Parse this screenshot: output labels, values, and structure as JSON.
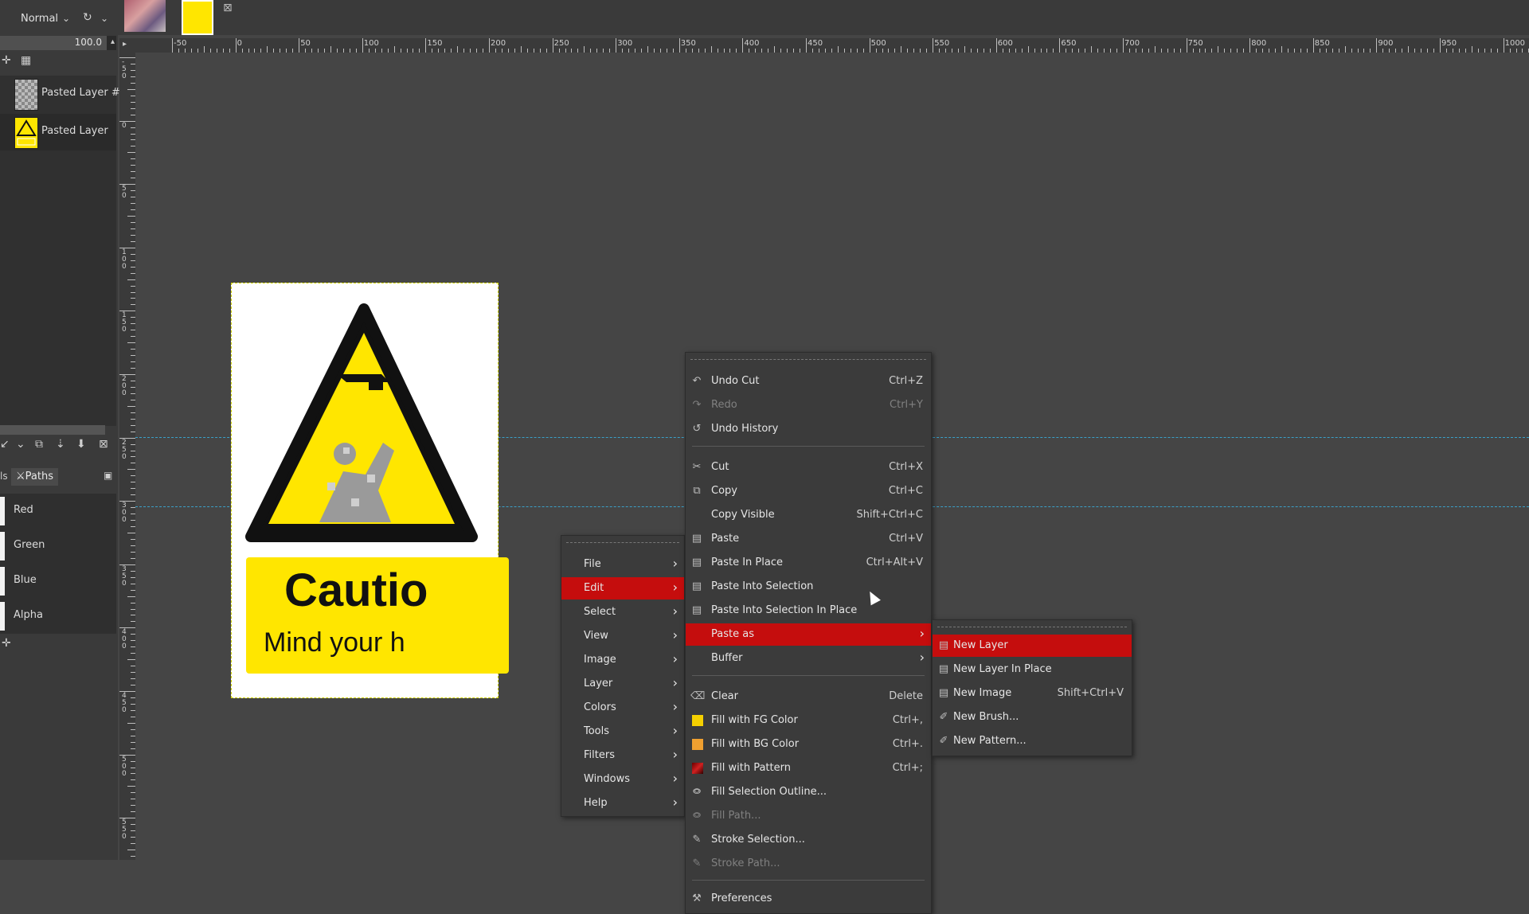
{
  "layers_panel": {
    "mode": "Normal",
    "opacity": "100.0",
    "layers": [
      {
        "name": "Pasted Layer #"
      },
      {
        "name": "Pasted Layer"
      }
    ]
  },
  "channels_panel": {
    "tab_label": "Paths",
    "tab_prefix": "ls",
    "channels": [
      "Red",
      "Green",
      "Blue",
      "Alpha"
    ]
  },
  "ruler": {
    "top_labels": [
      "-50",
      "0",
      "50",
      "100",
      "150",
      "200",
      "250",
      "300",
      "350",
      "400",
      "450",
      "500",
      "550",
      "600",
      "650",
      "700",
      "750",
      "800",
      "850",
      "900",
      "950",
      "1000"
    ],
    "left_labels": [
      "-50",
      "0",
      "50",
      "100",
      "150",
      "200",
      "250",
      "300",
      "350",
      "400",
      "450",
      "500",
      "550",
      "600"
    ]
  },
  "canvas_image": {
    "caution_title": "Cautio",
    "caution_subtitle": "Mind your h"
  },
  "main_menu": {
    "items": [
      "File",
      "Edit",
      "Select",
      "View",
      "Image",
      "Layer",
      "Colors",
      "Tools",
      "Filters",
      "Windows",
      "Help"
    ],
    "highlighted": "Edit"
  },
  "edit_menu": {
    "items": [
      {
        "label": "Undo Cut",
        "shortcut": "Ctrl+Z",
        "icon": "undo-icon",
        "enabled": true
      },
      {
        "label": "Redo",
        "shortcut": "Ctrl+Y",
        "icon": "redo-icon",
        "enabled": false
      },
      {
        "label": "Undo History",
        "shortcut": "",
        "icon": "history-icon",
        "enabled": true
      },
      {
        "label": "Cut",
        "shortcut": "Ctrl+X",
        "icon": "scissors-icon",
        "enabled": true
      },
      {
        "label": "Copy",
        "shortcut": "Ctrl+C",
        "icon": "copy-icon",
        "enabled": true
      },
      {
        "label": "Copy Visible",
        "shortcut": "Shift+Ctrl+C",
        "icon": "",
        "enabled": true
      },
      {
        "label": "Paste",
        "shortcut": "Ctrl+V",
        "icon": "paste-icon",
        "enabled": true
      },
      {
        "label": "Paste In Place",
        "shortcut": "Ctrl+Alt+V",
        "icon": "paste-icon",
        "enabled": true
      },
      {
        "label": "Paste Into Selection",
        "shortcut": "",
        "icon": "paste-icon",
        "enabled": true
      },
      {
        "label": "Paste Into Selection In Place",
        "shortcut": "",
        "icon": "paste-icon",
        "enabled": true
      },
      {
        "label": "Paste as",
        "shortcut": "",
        "icon": "",
        "enabled": true,
        "submenu": true
      },
      {
        "label": "Buffer",
        "shortcut": "",
        "icon": "",
        "enabled": true,
        "submenu": true
      },
      {
        "label": "Clear",
        "shortcut": "Delete",
        "icon": "clear-icon",
        "enabled": true
      },
      {
        "label": "Fill with FG Color",
        "shortcut": "Ctrl+,",
        "icon": "fg-color-swatch",
        "enabled": true
      },
      {
        "label": "Fill with BG Color",
        "shortcut": "Ctrl+.",
        "icon": "bg-color-swatch",
        "enabled": true
      },
      {
        "label": "Fill with Pattern",
        "shortcut": "Ctrl+;",
        "icon": "pattern-swatch",
        "enabled": true
      },
      {
        "label": "Fill Selection Outline...",
        "shortcut": "",
        "icon": "fill-icon",
        "enabled": true
      },
      {
        "label": "Fill Path...",
        "shortcut": "",
        "icon": "fill-icon",
        "enabled": false
      },
      {
        "label": "Stroke Selection...",
        "shortcut": "",
        "icon": "stroke-icon",
        "enabled": true
      },
      {
        "label": "Stroke Path...",
        "shortcut": "",
        "icon": "stroke-icon",
        "enabled": false
      },
      {
        "label": "Preferences",
        "shortcut": "",
        "icon": "preferences-icon",
        "enabled": true
      }
    ],
    "highlighted": "Paste as"
  },
  "paste_as_menu": {
    "items": [
      {
        "label": "New Layer",
        "shortcut": ""
      },
      {
        "label": "New Layer In Place",
        "shortcut": ""
      },
      {
        "label": "New Image",
        "shortcut": "Shift+Ctrl+V"
      },
      {
        "label": "New Brush...",
        "shortcut": ""
      },
      {
        "label": "New Pattern...",
        "shortcut": ""
      }
    ],
    "highlighted": "New Layer"
  },
  "colors": {
    "menu_highlight": "#c50d0d",
    "fg_color": "#f5d000",
    "bg_color": "#f0a030",
    "caution_yellow": "#ffe600"
  }
}
